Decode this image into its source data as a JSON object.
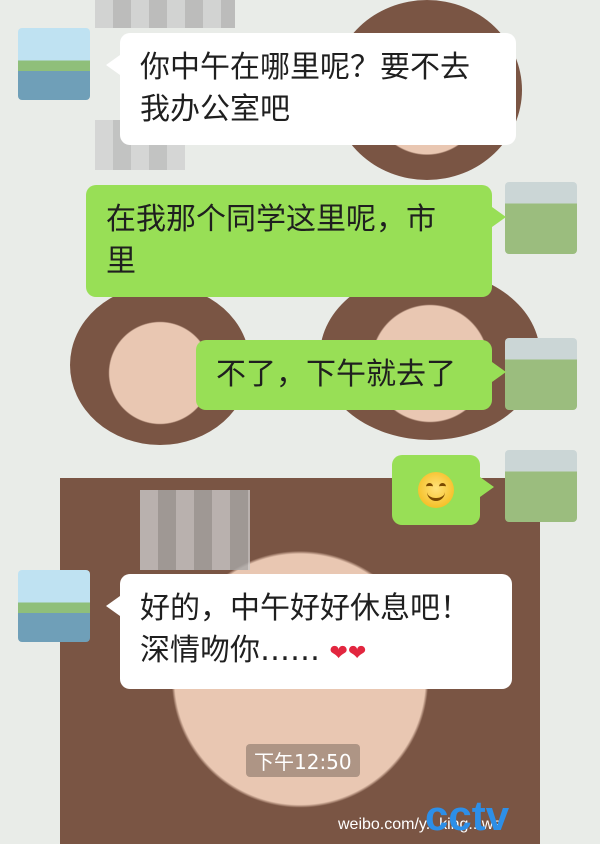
{
  "messages": [
    {
      "side": "left",
      "text_lines": [
        "你中午在哪里呢？要不去",
        "我办公室吧"
      ]
    },
    {
      "side": "right",
      "text_lines": [
        "在我那个同学这里呢，市",
        "里"
      ]
    },
    {
      "side": "right",
      "text_lines": [
        "不了，下午就去了"
      ]
    },
    {
      "side": "right",
      "emoji": "smiling-face-icon"
    },
    {
      "side": "left",
      "text_lines": [
        "好的，中午好好休息吧！",
        "深情吻你……"
      ],
      "trailing_icon": "kiss-lips-icon"
    }
  ],
  "timestamp": "下午12:50",
  "watermark": {
    "weibo": "weibo.com/y...king...ws",
    "brand": "cctv"
  }
}
